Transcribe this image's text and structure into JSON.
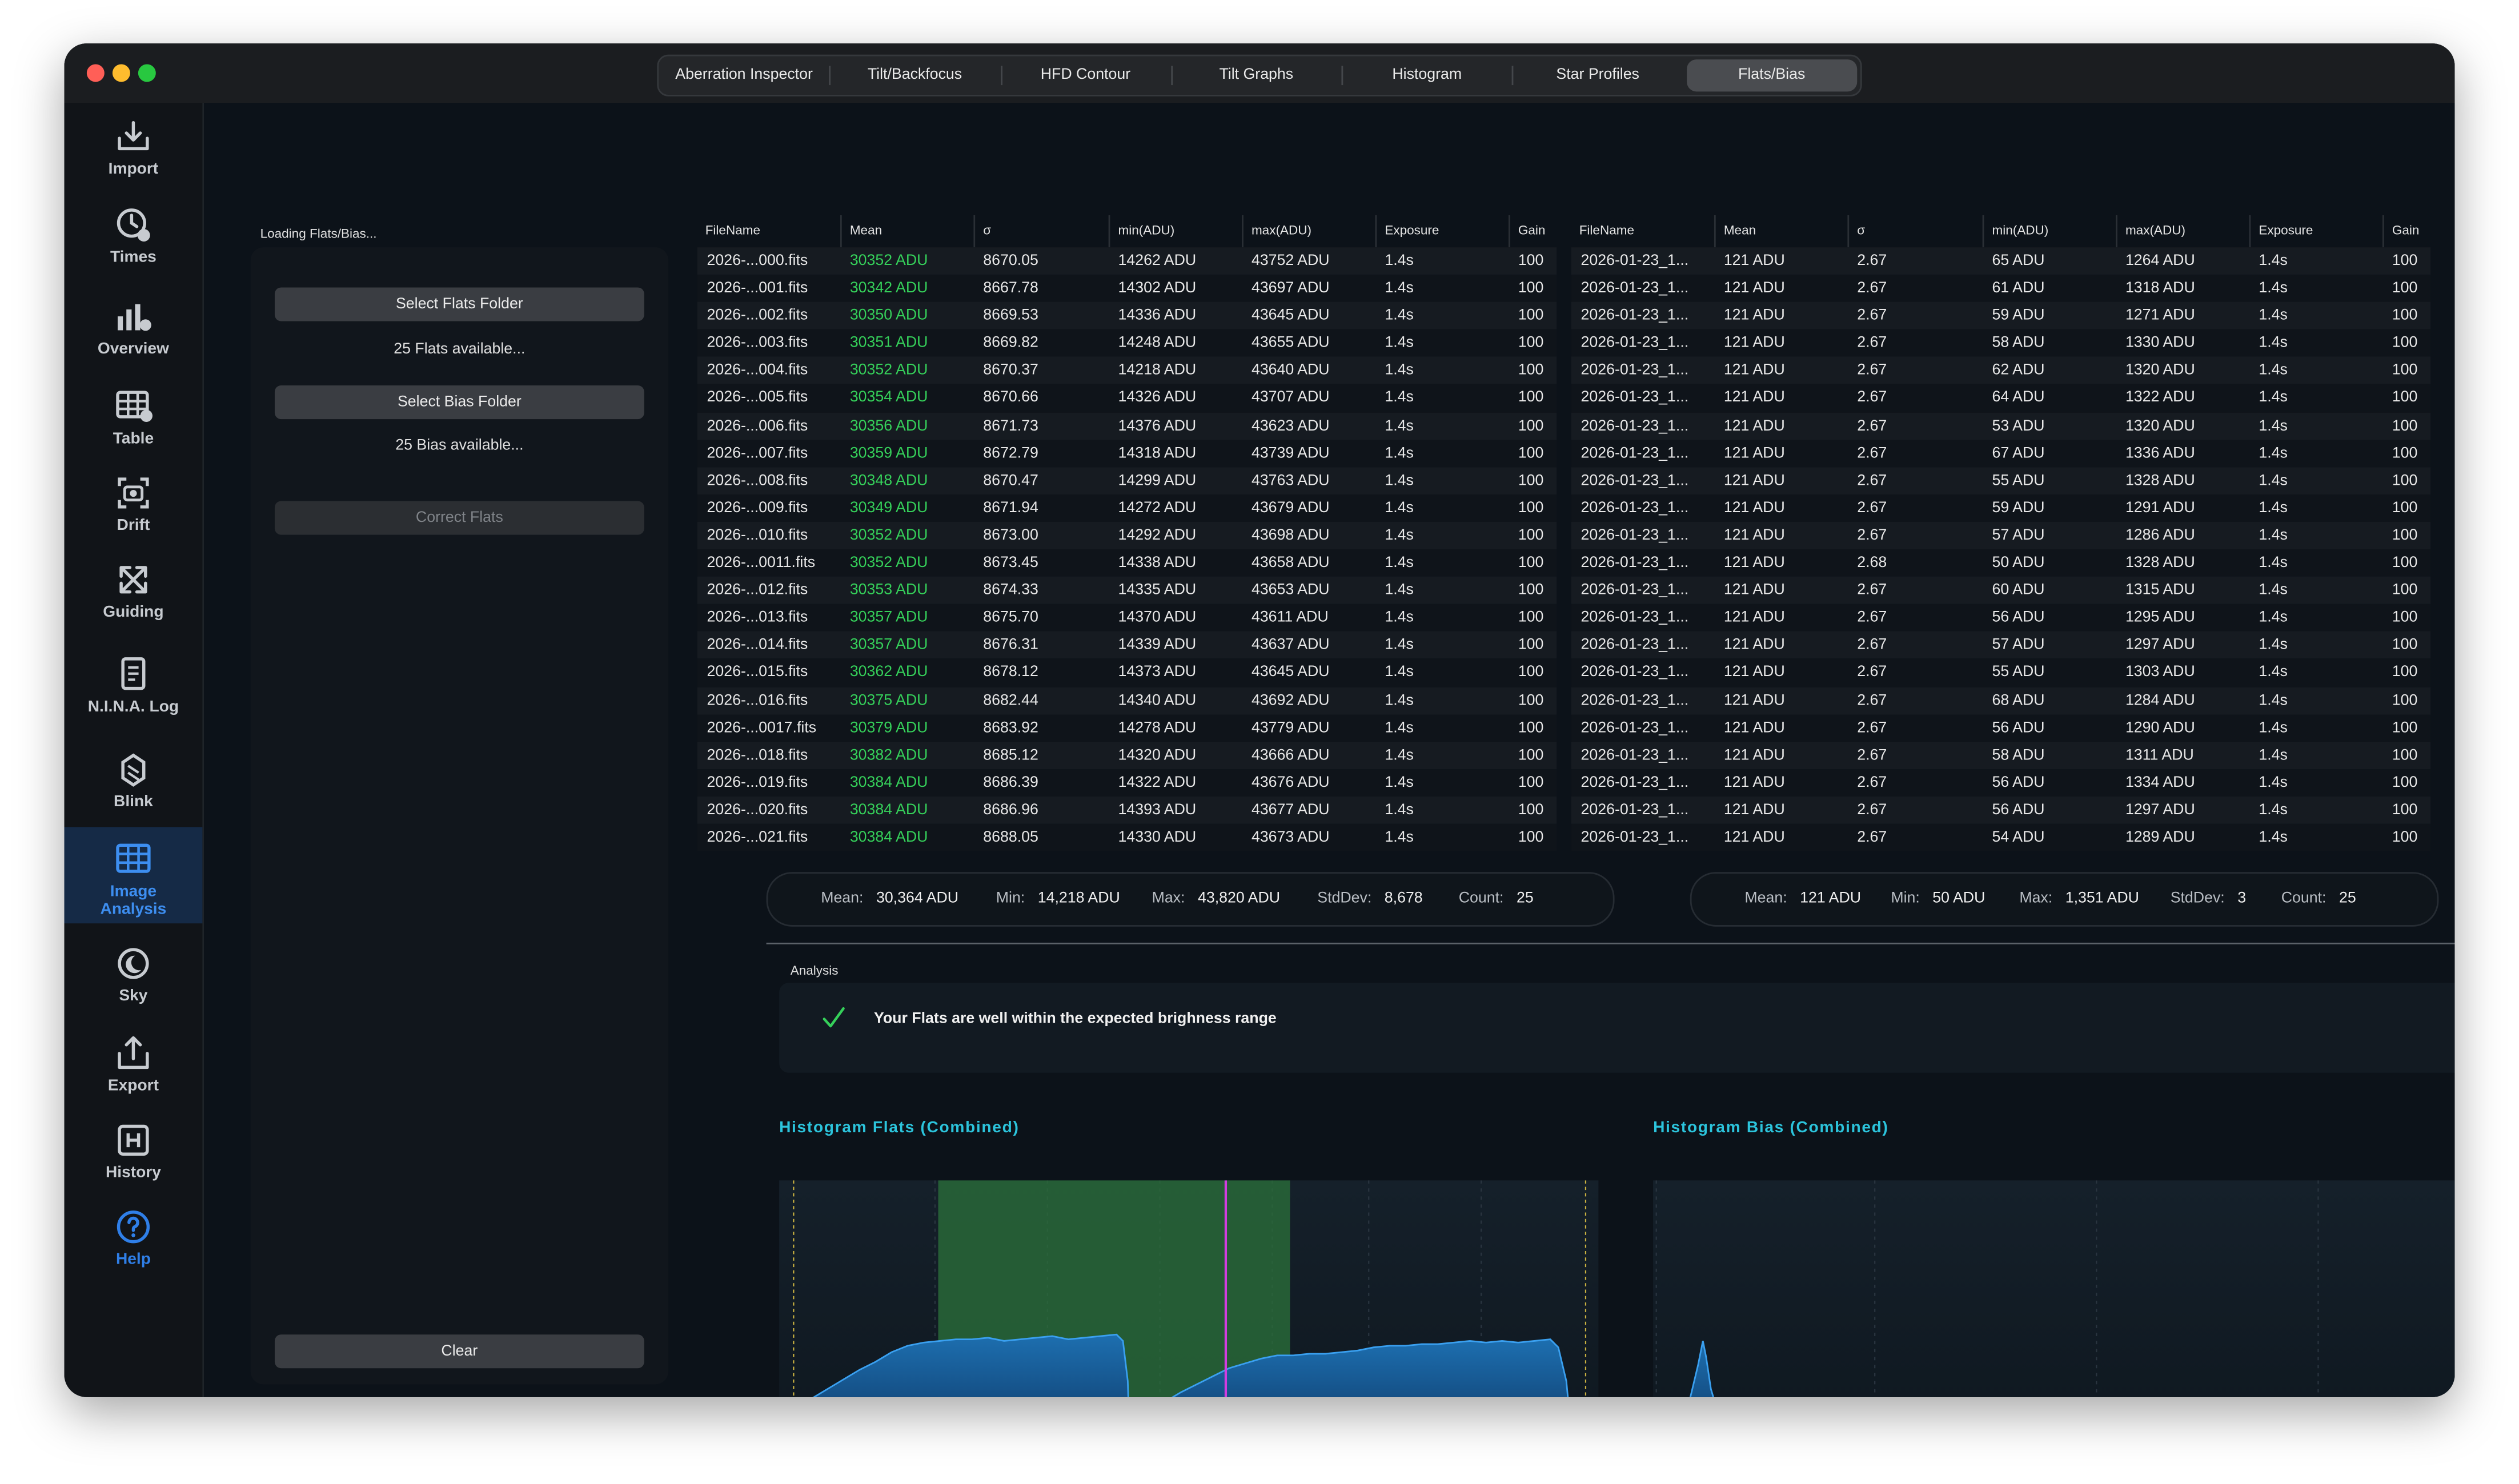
{
  "tabs": [
    {
      "label": "Aberration Inspector",
      "active": false
    },
    {
      "label": "Tilt/Backfocus",
      "active": false
    },
    {
      "label": "HFD Contour",
      "active": false
    },
    {
      "label": "Tilt Graphs",
      "active": false
    },
    {
      "label": "Histogram",
      "active": false
    },
    {
      "label": "Star Profiles",
      "active": false
    },
    {
      "label": "Flats/Bias",
      "active": true
    }
  ],
  "sidebar": {
    "items": [
      {
        "label": "Import",
        "icon": "import-icon"
      },
      {
        "label": "Times",
        "icon": "clock-icon"
      },
      {
        "label": "Overview",
        "icon": "bar-chart-icon"
      },
      {
        "label": "Table",
        "icon": "table-icon"
      },
      {
        "label": "Drift",
        "icon": "camera-viewfinder-icon"
      },
      {
        "label": "Guiding",
        "icon": "arrows-expand-icon"
      },
      {
        "label": "N.I.N.A. Log",
        "icon": "document-icon"
      },
      {
        "label": "Blink",
        "icon": "stack-icon"
      },
      {
        "label": "Image\nAnalysis",
        "icon": "grid-icon",
        "active": true
      },
      {
        "label": "Sky",
        "icon": "moon-icon"
      },
      {
        "label": "Export",
        "icon": "export-icon"
      },
      {
        "label": "History",
        "icon": "history-icon"
      },
      {
        "label": "Help",
        "icon": "help-icon"
      }
    ]
  },
  "left_panel": {
    "loading_label": "Loading Flats/Bias...",
    "select_flats_label": "Select Flats Folder",
    "flats_available": "25 Flats available...",
    "select_bias_label": "Select Bias Folder",
    "bias_available": "25 Bias available...",
    "correct_flats_label": "Correct Flats",
    "clear_label": "Clear"
  },
  "flats_table": {
    "columns": [
      "FileName",
      "Mean",
      "σ",
      "min(ADU)",
      "max(ADU)",
      "Exposure",
      "Gain"
    ],
    "rows": [
      [
        "2026-...000.fits",
        "30352 ADU",
        "8670.05",
        "14262 ADU",
        "43752 ADU",
        "1.4s",
        "100"
      ],
      [
        "2026-...001.fits",
        "30342 ADU",
        "8667.78",
        "14302 ADU",
        "43697 ADU",
        "1.4s",
        "100"
      ],
      [
        "2026-...002.fits",
        "30350 ADU",
        "8669.53",
        "14336 ADU",
        "43645 ADU",
        "1.4s",
        "100"
      ],
      [
        "2026-...003.fits",
        "30351 ADU",
        "8669.82",
        "14248 ADU",
        "43655 ADU",
        "1.4s",
        "100"
      ],
      [
        "2026-...004.fits",
        "30352 ADU",
        "8670.37",
        "14218 ADU",
        "43640 ADU",
        "1.4s",
        "100"
      ],
      [
        "2026-...005.fits",
        "30354 ADU",
        "8670.66",
        "14326 ADU",
        "43707 ADU",
        "1.4s",
        "100"
      ],
      [
        "2026-...006.fits",
        "30356 ADU",
        "8671.73",
        "14376 ADU",
        "43623 ADU",
        "1.4s",
        "100"
      ],
      [
        "2026-...007.fits",
        "30359 ADU",
        "8672.79",
        "14318 ADU",
        "43739 ADU",
        "1.4s",
        "100"
      ],
      [
        "2026-...008.fits",
        "30348 ADU",
        "8670.47",
        "14299 ADU",
        "43763 ADU",
        "1.4s",
        "100"
      ],
      [
        "2026-...009.fits",
        "30349 ADU",
        "8671.94",
        "14272 ADU",
        "43679 ADU",
        "1.4s",
        "100"
      ],
      [
        "2026-...010.fits",
        "30352 ADU",
        "8673.00",
        "14292 ADU",
        "43698 ADU",
        "1.4s",
        "100"
      ],
      [
        "2026-...0011.fits",
        "30352 ADU",
        "8673.45",
        "14338 ADU",
        "43658 ADU",
        "1.4s",
        "100"
      ],
      [
        "2026-...012.fits",
        "30353 ADU",
        "8674.33",
        "14335 ADU",
        "43653 ADU",
        "1.4s",
        "100"
      ],
      [
        "2026-...013.fits",
        "30357 ADU",
        "8675.70",
        "14370 ADU",
        "43611 ADU",
        "1.4s",
        "100"
      ],
      [
        "2026-...014.fits",
        "30357 ADU",
        "8676.31",
        "14339 ADU",
        "43637 ADU",
        "1.4s",
        "100"
      ],
      [
        "2026-...015.fits",
        "30362 ADU",
        "8678.12",
        "14373 ADU",
        "43645 ADU",
        "1.4s",
        "100"
      ],
      [
        "2026-...016.fits",
        "30375 ADU",
        "8682.44",
        "14340 ADU",
        "43692 ADU",
        "1.4s",
        "100"
      ],
      [
        "2026-...0017.fits",
        "30379 ADU",
        "8683.92",
        "14278 ADU",
        "43779 ADU",
        "1.4s",
        "100"
      ],
      [
        "2026-...018.fits",
        "30382 ADU",
        "8685.12",
        "14320 ADU",
        "43666 ADU",
        "1.4s",
        "100"
      ],
      [
        "2026-...019.fits",
        "30384 ADU",
        "8686.39",
        "14322 ADU",
        "43676 ADU",
        "1.4s",
        "100"
      ],
      [
        "2026-...020.fits",
        "30384 ADU",
        "8686.96",
        "14393 ADU",
        "43677 ADU",
        "1.4s",
        "100"
      ],
      [
        "2026-...021.fits",
        "30384 ADU",
        "8688.05",
        "14330 ADU",
        "43673 ADU",
        "1.4s",
        "100"
      ]
    ]
  },
  "bias_table": {
    "columns": [
      "FileName",
      "Mean",
      "σ",
      "min(ADU)",
      "max(ADU)",
      "Exposure",
      "Gain"
    ],
    "rows": [
      [
        "2026-01-23_1...",
        "121 ADU",
        "2.67",
        "65 ADU",
        "1264 ADU",
        "1.4s",
        "100"
      ],
      [
        "2026-01-23_1...",
        "121 ADU",
        "2.67",
        "61 ADU",
        "1318 ADU",
        "1.4s",
        "100"
      ],
      [
        "2026-01-23_1...",
        "121 ADU",
        "2.67",
        "59 ADU",
        "1271 ADU",
        "1.4s",
        "100"
      ],
      [
        "2026-01-23_1...",
        "121 ADU",
        "2.67",
        "58 ADU",
        "1330 ADU",
        "1.4s",
        "100"
      ],
      [
        "2026-01-23_1...",
        "121 ADU",
        "2.67",
        "62 ADU",
        "1320 ADU",
        "1.4s",
        "100"
      ],
      [
        "2026-01-23_1...",
        "121 ADU",
        "2.67",
        "64 ADU",
        "1322 ADU",
        "1.4s",
        "100"
      ],
      [
        "2026-01-23_1...",
        "121 ADU",
        "2.67",
        "53 ADU",
        "1320 ADU",
        "1.4s",
        "100"
      ],
      [
        "2026-01-23_1...",
        "121 ADU",
        "2.67",
        "67 ADU",
        "1336 ADU",
        "1.4s",
        "100"
      ],
      [
        "2026-01-23_1...",
        "121 ADU",
        "2.67",
        "55 ADU",
        "1328 ADU",
        "1.4s",
        "100"
      ],
      [
        "2026-01-23_1...",
        "121 ADU",
        "2.67",
        "59 ADU",
        "1291 ADU",
        "1.4s",
        "100"
      ],
      [
        "2026-01-23_1...",
        "121 ADU",
        "2.67",
        "57 ADU",
        "1286 ADU",
        "1.4s",
        "100"
      ],
      [
        "2026-01-23_1...",
        "121 ADU",
        "2.68",
        "50 ADU",
        "1328 ADU",
        "1.4s",
        "100"
      ],
      [
        "2026-01-23_1...",
        "121 ADU",
        "2.67",
        "60 ADU",
        "1315 ADU",
        "1.4s",
        "100"
      ],
      [
        "2026-01-23_1...",
        "121 ADU",
        "2.67",
        "56 ADU",
        "1295 ADU",
        "1.4s",
        "100"
      ],
      [
        "2026-01-23_1...",
        "121 ADU",
        "2.67",
        "57 ADU",
        "1297 ADU",
        "1.4s",
        "100"
      ],
      [
        "2026-01-23_1...",
        "121 ADU",
        "2.67",
        "55 ADU",
        "1303 ADU",
        "1.4s",
        "100"
      ],
      [
        "2026-01-23_1...",
        "121 ADU",
        "2.67",
        "68 ADU",
        "1284 ADU",
        "1.4s",
        "100"
      ],
      [
        "2026-01-23_1...",
        "121 ADU",
        "2.67",
        "56 ADU",
        "1290 ADU",
        "1.4s",
        "100"
      ],
      [
        "2026-01-23_1...",
        "121 ADU",
        "2.67",
        "58 ADU",
        "1311 ADU",
        "1.4s",
        "100"
      ],
      [
        "2026-01-23_1...",
        "121 ADU",
        "2.67",
        "56 ADU",
        "1334 ADU",
        "1.4s",
        "100"
      ],
      [
        "2026-01-23_1...",
        "121 ADU",
        "2.67",
        "56 ADU",
        "1297 ADU",
        "1.4s",
        "100"
      ],
      [
        "2026-01-23_1...",
        "121 ADU",
        "2.67",
        "54 ADU",
        "1289 ADU",
        "1.4s",
        "100"
      ]
    ]
  },
  "flats_stats": {
    "mean_label": "Mean:",
    "mean": "30,364 ADU",
    "min_label": "Min:",
    "min": "14,218 ADU",
    "max_label": "Max:",
    "max": "43,820 ADU",
    "stddev_label": "StdDev:",
    "stddev": "8,678",
    "count_label": "Count:",
    "count": "25"
  },
  "bias_stats": {
    "mean_label": "Mean:",
    "mean": "121 ADU",
    "min_label": "Min:",
    "min": "50 ADU",
    "max_label": "Max:",
    "max": "1,351 ADU",
    "stddev_label": "StdDev:",
    "stddev": "3",
    "count_label": "Count:",
    "count": "25"
  },
  "analysis": {
    "label": "Analysis",
    "message": "Your Flats are well within the expected brighness range",
    "status_color": "#35d05a"
  },
  "histograms": {
    "flats_title": "Histogram Flats (Combined)",
    "bias_title": "Histogram Bias (Combined)"
  },
  "colors": {
    "accent_green": "#35d05a",
    "histogram_title": "#2cc4dc",
    "active_sidebar": "#3d8ef0",
    "mean_marker": "#d23de0"
  }
}
